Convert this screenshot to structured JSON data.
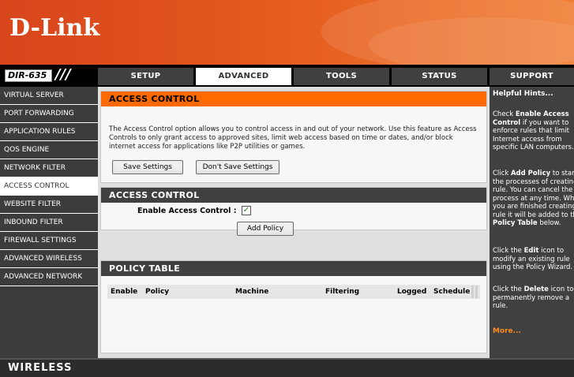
{
  "brand": {
    "logo_text": "D-Link",
    "model": "DIR-635",
    "model_slash": "///"
  },
  "colors": {
    "header_orange": "#e3561d",
    "panel_orange": "#ff6a00",
    "dark_gray": "#404040",
    "hint_link": "#ff8a1e"
  },
  "nav": {
    "tabs": [
      {
        "label": "SETUP",
        "active": false
      },
      {
        "label": "ADVANCED",
        "active": true
      },
      {
        "label": "TOOLS",
        "active": false
      },
      {
        "label": "STATUS",
        "active": false
      },
      {
        "label": "SUPPORT",
        "active": false
      }
    ]
  },
  "sidebar": {
    "items": [
      {
        "label": "VIRTUAL SERVER",
        "active": false
      },
      {
        "label": "PORT FORWARDING",
        "active": false
      },
      {
        "label": "APPLICATION RULES",
        "active": false
      },
      {
        "label": "QOS ENGINE",
        "active": false
      },
      {
        "label": "NETWORK FILTER",
        "active": false
      },
      {
        "label": "ACCESS CONTROL",
        "active": true
      },
      {
        "label": "WEBSITE FILTER",
        "active": false
      },
      {
        "label": "INBOUND FILTER",
        "active": false
      },
      {
        "label": "FIREWALL SETTINGS",
        "active": false
      },
      {
        "label": "ADVANCED WIRELESS",
        "active": false
      },
      {
        "label": "ADVANCED NETWORK",
        "active": false
      }
    ]
  },
  "intro": {
    "title": "ACCESS CONTROL",
    "text": "The Access Control option allows you to control access in and out of your network. Use this feature as Access Controls to only grant access to approved sites, limit web access based on time or dates, and/or block internet access for applications like P2P utilities or games.",
    "save_label": "Save Settings",
    "dont_save_label": "Don't Save Settings"
  },
  "access_control": {
    "title": "ACCESS CONTROL",
    "enable_label": "Enable Access Control :",
    "enabled": true,
    "check_glyph": "✓",
    "add_policy_label": "Add Policy"
  },
  "policy_table": {
    "title": "POLICY TABLE",
    "columns": [
      "Enable",
      "Policy",
      "Machine",
      "Filtering",
      "Logged",
      "Schedule"
    ]
  },
  "hints": {
    "title": "Helpful Hints...",
    "hint1": {
      "l1a": "Check ",
      "l1b": "Enable Access",
      "l2a": "Control",
      "l2b": " if you want to",
      "l3": "enforce rules that limit",
      "l4": "Internet access from",
      "l5": "specific LAN computers."
    },
    "hint2": {
      "l1a": "Click ",
      "l1b": "Add Policy",
      "l1c": " to start",
      "l2": "the processes of creating a",
      "l3": "rule. You can cancel the",
      "l4": "process at any time. When",
      "l5": "you are finished creating a",
      "l6": "rule it will be added to the",
      "l7": "Policy Table",
      "l7b": " below."
    },
    "hint3": {
      "l1a": "Click the ",
      "l1b": "Edit",
      "l1c": " icon to",
      "l2": "modify an existing rule",
      "l3": "using the Policy Wizard."
    },
    "hint4": {
      "l1a": "Click the ",
      "l1b": "Delete",
      "l1c": " icon to",
      "l2": "permanently remove a",
      "l3": "rule."
    },
    "more_label": "More..."
  },
  "footer": {
    "label": "WIRELESS"
  }
}
